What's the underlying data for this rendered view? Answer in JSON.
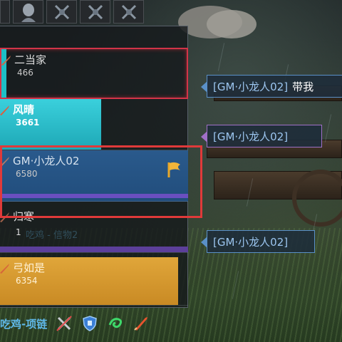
{
  "toolbar": {
    "slots": [
      "blank-slot",
      "head-portrait-icon",
      "crossed-swords-icon",
      "crossed-swords-icon",
      "crossed-swords-icon"
    ]
  },
  "team": {
    "members": [
      {
        "name": "二当家",
        "score": "466"
      },
      {
        "name": "风晴",
        "score": "3661"
      },
      {
        "name": "GM·小龙人02",
        "score": "6580"
      },
      {
        "name": "归寒",
        "score": "1"
      },
      {
        "name": "弓如是",
        "score": "6354"
      }
    ],
    "ghost_text": "吃鸡 - 信物2"
  },
  "chat": {
    "messages": [
      {
        "tag": "[GM·小龙人02]",
        "text": "带我"
      },
      {
        "tag": "[GM·小龙人02]",
        "text": ""
      },
      {
        "tag": "[GM·小龙人02]",
        "text": ""
      }
    ]
  },
  "equipment": {
    "title": "吃鸡-项链",
    "icons": [
      "crossed-out-swords-icon",
      "shield-icon",
      "wind-swirl-icon",
      "blade-icon"
    ]
  },
  "colors": {
    "cyan_fill": "#1ea8b6",
    "blue_row": "#214d7c",
    "purple_bar": "#6a4fc0",
    "gold_fill": "#c98a24",
    "red_highlight": "#e03a3a"
  }
}
